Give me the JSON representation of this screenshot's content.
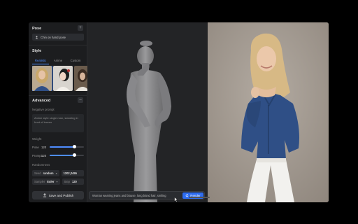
{
  "panel": {
    "pose_title": "Pose",
    "pose_value": "Chin on hand pose",
    "style_title": "Style",
    "tabs": [
      {
        "label": "Realistic",
        "active": true
      },
      {
        "label": "Anime",
        "active": false
      },
      {
        "label": "Custom",
        "active": false
      }
    ],
    "advanced_title": "Advanced",
    "negative_label": "Negative prompt",
    "negative_text": "Anime style single man, standing in front of leaves",
    "weight_label": "Weight",
    "sliders": [
      {
        "label": "Pose",
        "value": "120",
        "fraction": 0.72
      },
      {
        "label": "Prompt",
        "value": "120",
        "fraction": 0.72
      }
    ],
    "randomness_label": "Randomness",
    "seed_key": "Seed",
    "seed_mode": "random",
    "seed_number": "1202,2455",
    "sampler_key": "Sampler",
    "sampler_value": "Euler",
    "step_key": "Step",
    "step_value": "120",
    "save_label": "Save and Publish"
  },
  "prompt": {
    "text": "Woman wearing jeans and blouse, long blond hair, smiling",
    "render_label": "Render"
  },
  "colors": {
    "accent": "#4e8dff",
    "render_button": "#2d6cf0",
    "panel_bg": "#1c1d1f"
  }
}
